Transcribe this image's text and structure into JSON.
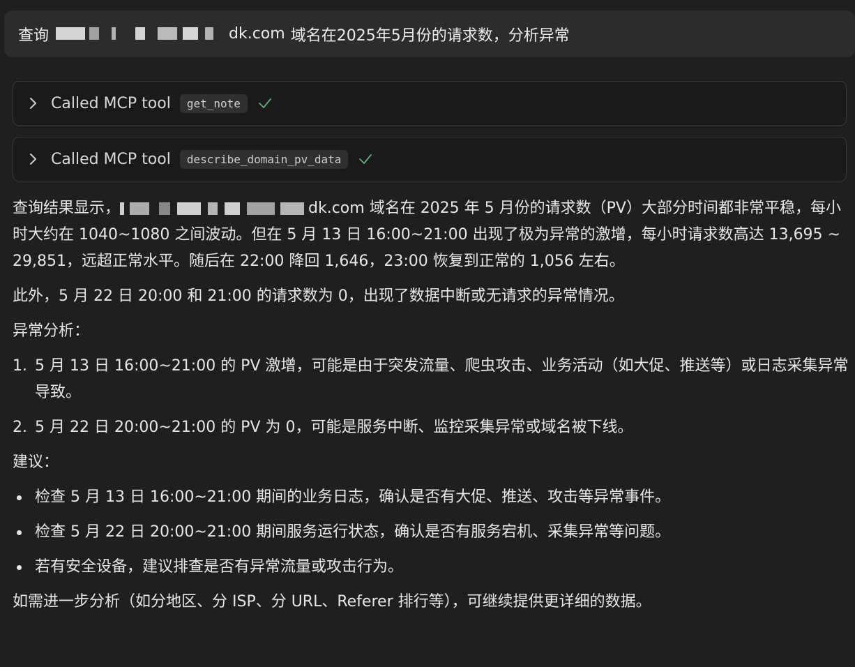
{
  "user_message": {
    "prefix": "查询",
    "domain_visible_suffix": "dk.com",
    "suffix": "域名在2025年5月份的请求数，分析异常"
  },
  "tool_calls": [
    {
      "label": "Called MCP tool",
      "tool": "get_note",
      "status": "success"
    },
    {
      "label": "Called MCP tool",
      "tool": "describe_domain_pv_data",
      "status": "success"
    }
  ],
  "response": {
    "summary_prefix": "查询结果显示，",
    "summary_domain_suffix": "dk.com",
    "summary_rest": " 域名在 2025 年 5 月份的请求数（PV）大部分时间都非常平稳，每小时大约在 1040~1080 之间波动。但在 5 月 13 日 16:00~21:00 出现了极为异常的激增，每小时请求数高达 13,695 ~ 29,851，远超正常水平。随后在 22:00 降回 1,646，23:00 恢复到正常的 1,056 左右。",
    "paragraph2": "此外，5 月 22 日 20:00 和 21:00 的请求数为 0，出现了数据中断或无请求的异常情况。",
    "analysis_heading": "异常分析：",
    "analysis_items": [
      {
        "num": "1.",
        "text": "5 月 13 日 16:00~21:00 的 PV 激增，可能是由于突发流量、爬虫攻击、业务活动（如大促、推送等）或日志采集异常导致。"
      },
      {
        "num": "2.",
        "text": "5 月 22 日 20:00~21:00 的 PV 为 0，可能是服务中断、监控采集异常或域名被下线。"
      }
    ],
    "suggestion_heading": "建议：",
    "suggestion_items": [
      "检查 5 月 13 日 16:00~21:00 期间的业务日志，确认是否有大促、推送、攻击等异常事件。",
      "检查 5 月 22 日 20:00~21:00 期间服务运行状态，确认是否有服务宕机、采集异常等问题。",
      "若有安全设备，建议排查是否有异常流量或攻击行为。"
    ],
    "closing": "如需进一步分析（如分地区、分 ISP、分 URL、Referer 排行等），可继续提供更详细的数据。"
  },
  "colors": {
    "background": "#1f1f1f",
    "bubble": "#2c2c2c",
    "check": "#5fb37a"
  }
}
